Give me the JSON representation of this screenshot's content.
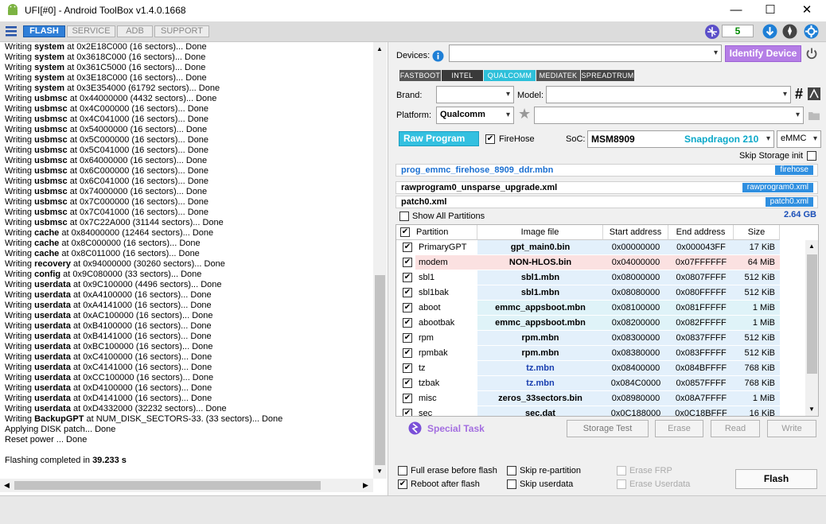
{
  "title": {
    "text": "UFI[#0] - Android ToolBox v1.4.0.1668",
    "minimize": "—",
    "maximize": "☐",
    "close": "✕"
  },
  "toolbar": {
    "tabs": [
      "FLASH",
      "SERVICE",
      "ADB",
      "SUPPORT"
    ],
    "counter": "5"
  },
  "log": [
    [
      "Writing ",
      "system",
      " at 0x2E18C000 (16 sectors)... Done"
    ],
    [
      "Writing ",
      "system",
      " at 0x3618C000 (16 sectors)... Done"
    ],
    [
      "Writing ",
      "system",
      " at 0x361C5000 (16 sectors)... Done"
    ],
    [
      "Writing ",
      "system",
      " at 0x3E18C000 (16 sectors)... Done"
    ],
    [
      "Writing ",
      "system",
      " at 0x3E354000 (61792 sectors)... Done"
    ],
    [
      "Writing ",
      "usbmsc",
      " at 0x44000000 (4432 sectors)... Done"
    ],
    [
      "Writing ",
      "usbmsc",
      " at 0x4C000000 (16 sectors)... Done"
    ],
    [
      "Writing ",
      "usbmsc",
      " at 0x4C041000 (16 sectors)... Done"
    ],
    [
      "Writing ",
      "usbmsc",
      " at 0x54000000 (16 sectors)... Done"
    ],
    [
      "Writing ",
      "usbmsc",
      " at 0x5C000000 (16 sectors)... Done"
    ],
    [
      "Writing ",
      "usbmsc",
      " at 0x5C041000 (16 sectors)... Done"
    ],
    [
      "Writing ",
      "usbmsc",
      " at 0x64000000 (16 sectors)... Done"
    ],
    [
      "Writing ",
      "usbmsc",
      " at 0x6C000000 (16 sectors)... Done"
    ],
    [
      "Writing ",
      "usbmsc",
      " at 0x6C041000 (16 sectors)... Done"
    ],
    [
      "Writing ",
      "usbmsc",
      " at 0x74000000 (16 sectors)... Done"
    ],
    [
      "Writing ",
      "usbmsc",
      " at 0x7C000000 (16 sectors)... Done"
    ],
    [
      "Writing ",
      "usbmsc",
      " at 0x7C041000 (16 sectors)... Done"
    ],
    [
      "Writing ",
      "usbmsc",
      " at 0x7C22A000 (31144 sectors)... Done"
    ],
    [
      "Writing ",
      "cache",
      " at 0x84000000 (12464 sectors)... Done"
    ],
    [
      "Writing ",
      "cache",
      " at 0x8C000000 (16 sectors)... Done"
    ],
    [
      "Writing ",
      "cache",
      " at 0x8C011000 (16 sectors)... Done"
    ],
    [
      "Writing ",
      "recovery",
      " at 0x94000000 (30260 sectors)... Done"
    ],
    [
      "Writing ",
      "config",
      " at 0x9C080000 (33 sectors)... Done"
    ],
    [
      "Writing ",
      "userdata",
      " at 0x9C100000 (4496 sectors)... Done"
    ],
    [
      "Writing ",
      "userdata",
      " at 0xA4100000 (16 sectors)... Done"
    ],
    [
      "Writing ",
      "userdata",
      " at 0xA4141000 (16 sectors)... Done"
    ],
    [
      "Writing ",
      "userdata",
      " at 0xAC100000 (16 sectors)... Done"
    ],
    [
      "Writing ",
      "userdata",
      " at 0xB4100000 (16 sectors)... Done"
    ],
    [
      "Writing ",
      "userdata",
      " at 0xB4141000 (16 sectors)... Done"
    ],
    [
      "Writing ",
      "userdata",
      " at 0xBC100000 (16 sectors)... Done"
    ],
    [
      "Writing ",
      "userdata",
      " at 0xC4100000 (16 sectors)... Done"
    ],
    [
      "Writing ",
      "userdata",
      " at 0xC4141000 (16 sectors)... Done"
    ],
    [
      "Writing ",
      "userdata",
      " at 0xCC100000 (16 sectors)... Done"
    ],
    [
      "Writing ",
      "userdata",
      " at 0xD4100000 (16 sectors)... Done"
    ],
    [
      "Writing ",
      "userdata",
      " at 0xD4141000 (16 sectors)... Done"
    ],
    [
      "Writing ",
      "userdata",
      " at 0xD4332000 (32232 sectors)... Done"
    ],
    [
      "Writing ",
      "BackupGPT",
      " at NUM_DISK_SECTORS-33. (33 sectors)... Done"
    ],
    [
      " Applying DISK patch... Done",
      "",
      ""
    ],
    [
      "Reset power ... Done",
      "",
      ""
    ],
    [
      "",
      "",
      ""
    ],
    [
      "Flashing completed in ",
      "39.233 s",
      ""
    ]
  ],
  "devices": {
    "label": "Devices:",
    "identify": "Identify Device"
  },
  "platforms": [
    "FASTBOOT",
    "INTEL",
    "QUALCOMM",
    "MEDIATEK",
    "SPREADTRUM"
  ],
  "brand": {
    "label": "Brand:",
    "model_label": "Model:"
  },
  "platform": {
    "label": "Platform:",
    "value": "Qualcomm"
  },
  "raw": {
    "button": "Raw Program",
    "firehose": "FireHose",
    "soc_label": "SoC:",
    "soc": "MSM8909",
    "soc_name": "Snapdragon 210",
    "storage": "eMMC",
    "skip_storage": "Skip Storage init"
  },
  "files": [
    {
      "name": "prog_emmc_firehose_8909_ddr.mbn",
      "tag": "firehose"
    },
    {
      "name": "rawprogram0_unsparse_upgrade.xml",
      "tag": "rawprogram0.xml"
    },
    {
      "name": "patch0.xml",
      "tag": "patch0.xml"
    }
  ],
  "show_all": "Show All Partitions",
  "total_size": "2.64 GB",
  "table": {
    "headers": [
      "Partition",
      "Image file",
      "Start address",
      "End address",
      "Size"
    ],
    "rows": [
      [
        "PrimaryGPT",
        "gpt_main0.bin",
        "0x00000000",
        "0x000043FF",
        "17 KiB",
        "#e3f0fb"
      ],
      [
        "modem",
        "NON-HLOS.bin",
        "0x04000000",
        "0x07FFFFFF",
        "64 MiB",
        "#fbe1e1"
      ],
      [
        "sbl1",
        "sbl1.mbn",
        "0x08000000",
        "0x0807FFFF",
        "512 KiB",
        "#e3f0fb"
      ],
      [
        "sbl1bak",
        "sbl1.mbn",
        "0x08080000",
        "0x080FFFFF",
        "512 KiB",
        "#e3f0fb"
      ],
      [
        "aboot",
        "emmc_appsboot.mbn",
        "0x08100000",
        "0x081FFFFF",
        "1 MiB",
        "#dff3f8"
      ],
      [
        "abootbak",
        "emmc_appsboot.mbn",
        "0x08200000",
        "0x082FFFFF",
        "1 MiB",
        "#dff3f8"
      ],
      [
        "rpm",
        "rpm.mbn",
        "0x08300000",
        "0x0837FFFF",
        "512 KiB",
        "#e3f0fb"
      ],
      [
        "rpmbak",
        "rpm.mbn",
        "0x08380000",
        "0x083FFFFF",
        "512 KiB",
        "#e3f0fb"
      ],
      [
        "tz",
        "tz.mbn",
        "0x08400000",
        "0x084BFFFF",
        "768 KiB",
        "#e3f0fb"
      ],
      [
        "tzbak",
        "tz.mbn",
        "0x084C0000",
        "0x0857FFFF",
        "768 KiB",
        "#e3f0fb"
      ],
      [
        "misc",
        "zeros_33sectors.bin",
        "0x08980000",
        "0x08A7FFFF",
        "1 MiB",
        "#e3f0fb"
      ],
      [
        "sec",
        "sec.dat",
        "0x0C188000",
        "0x0C18BFFF",
        "16 KiB",
        "#e3f0fb"
      ]
    ]
  },
  "actions": {
    "special": "Special Task",
    "storage_test": "Storage Test",
    "erase": "Erase",
    "read": "Read",
    "write": "Write"
  },
  "options": {
    "full_erase": "Full erase before flash",
    "skip_repartition": "Skip re-partition",
    "erase_frp": "Erase FRP",
    "reboot": "Reboot after flash",
    "skip_userdata": "Skip userdata",
    "erase_userdata": "Erase Userdata",
    "flash": "Flash"
  },
  "colors": {
    "accent": "#2f7fd8",
    "identify": "#b57ee6",
    "raw_program": "#33c0e0",
    "soc_name": "#0aa8c8",
    "link": "#1a6fd1",
    "counter": "#008800"
  }
}
